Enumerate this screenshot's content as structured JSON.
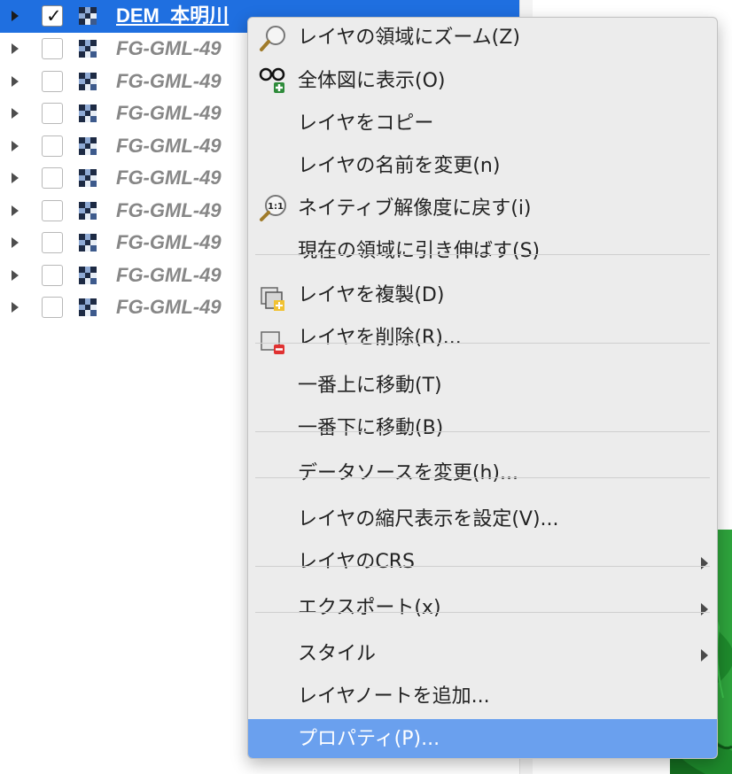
{
  "layer_tree": {
    "selected_layer": {
      "name": "DEM_本明川",
      "checked": true
    },
    "layers": [
      {
        "name": "FG-GML-49",
        "checked": false
      },
      {
        "name": "FG-GML-49",
        "checked": false
      },
      {
        "name": "FG-GML-49",
        "checked": false
      },
      {
        "name": "FG-GML-49",
        "checked": false
      },
      {
        "name": "FG-GML-49",
        "checked": false
      },
      {
        "name": "FG-GML-49",
        "checked": false
      },
      {
        "name": "FG-GML-49",
        "checked": false
      },
      {
        "name": "FG-GML-49",
        "checked": false
      },
      {
        "name": "FG-GML-49",
        "checked": false
      }
    ],
    "checkmark": "✓"
  },
  "context_menu": {
    "items": [
      {
        "label": "レイヤの領域にズーム(Z)",
        "icon": "zoom-to-layer-icon"
      },
      {
        "label": "全体図に表示(O)",
        "icon": "show-in-overview-icon"
      },
      {
        "label": "レイヤをコピー"
      },
      {
        "label": "レイヤの名前を変更(n)"
      },
      {
        "label": "ネイティブ解像度に戻す(i)",
        "icon": "zoom-native-resolution-icon",
        "icon_text": "1:1"
      },
      {
        "label": "現在の領域に引き伸ばす(S)"
      },
      {
        "label": "レイヤを複製(D)",
        "icon": "duplicate-layer-icon"
      },
      {
        "label": "レイヤを削除(R)...",
        "icon": "remove-layer-icon"
      },
      {
        "label": "一番上に移動(T)"
      },
      {
        "label": "一番下に移動(B)"
      },
      {
        "label": "データソースを変更(h)..."
      },
      {
        "label": "レイヤの縮尺表示を設定(V)..."
      },
      {
        "label": "レイヤのCRS",
        "submenu": true
      },
      {
        "label": "エクスポート(x)",
        "submenu": true
      },
      {
        "label": "スタイル",
        "submenu": true
      },
      {
        "label": "レイヤノートを追加..."
      },
      {
        "label": "プロパティ(P)...",
        "highlighted": true
      }
    ]
  },
  "colors": {
    "selection": "#1f6fe0",
    "menu_background": "#ececec",
    "menu_highlight": "#6aa0ee",
    "terrain": "#1e8a2c"
  }
}
